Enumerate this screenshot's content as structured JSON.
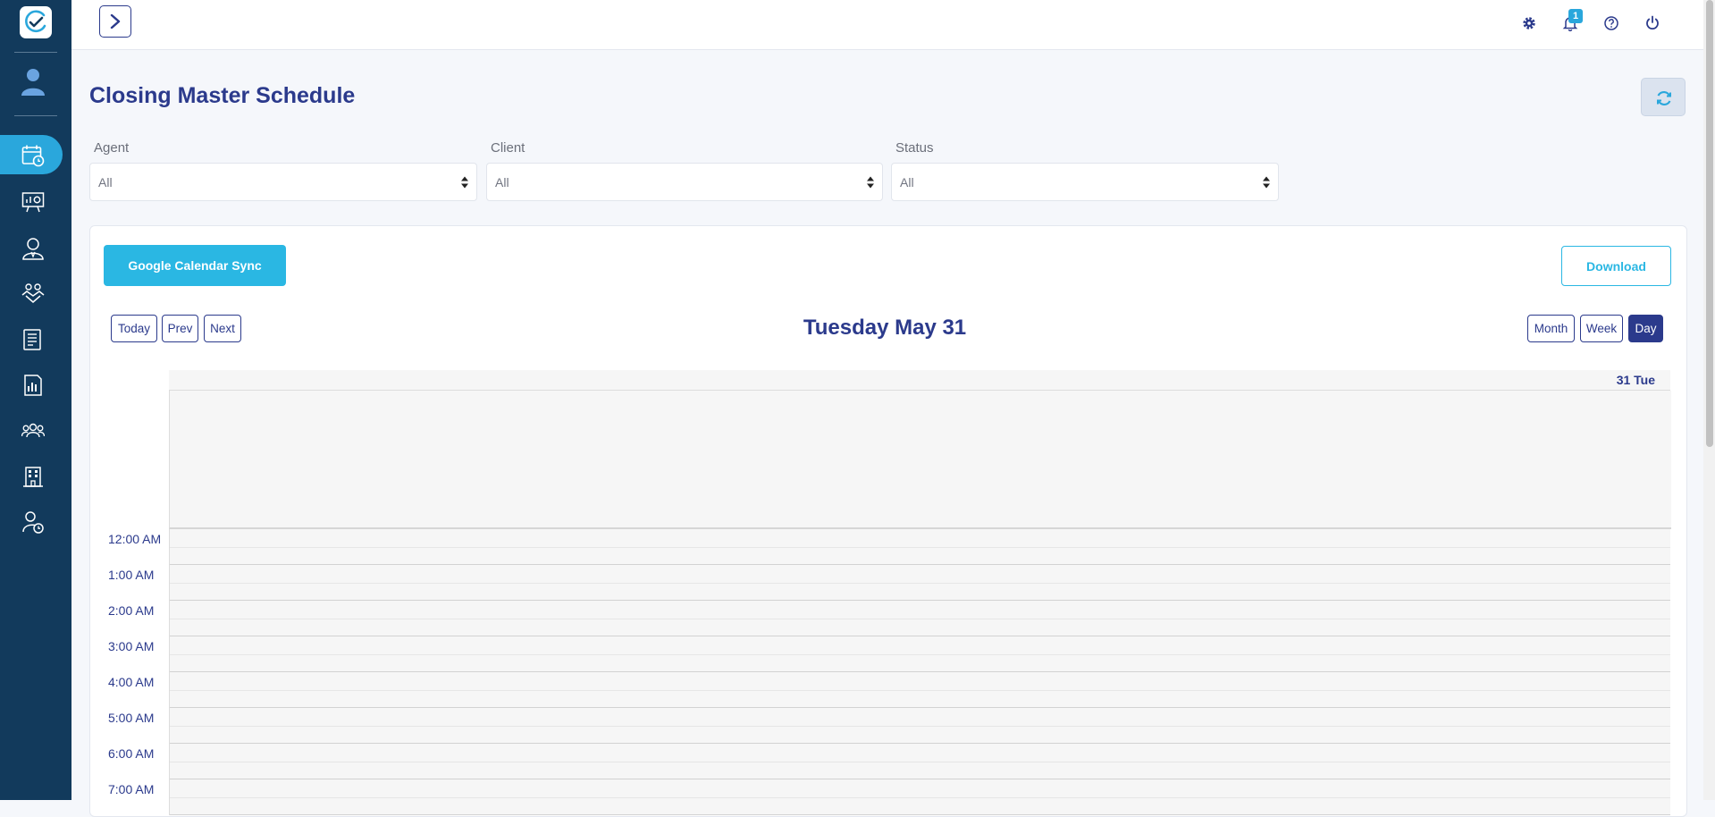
{
  "page": {
    "title": "Closing Master Schedule"
  },
  "colors": {
    "sidebar": "#123a5c",
    "accent": "#2aa7dc",
    "primary": "#2b3a8c",
    "button_blue": "#2ab7e3"
  },
  "topbar": {
    "notification_count": "1"
  },
  "sidebar": {
    "items": [
      {
        "icon": "calendar-clock-icon",
        "active": true
      },
      {
        "icon": "presentation-board-icon"
      },
      {
        "icon": "agent-icon"
      },
      {
        "icon": "handshake-icon"
      },
      {
        "icon": "ledger-book-icon"
      },
      {
        "icon": "bar-chart-report-icon"
      },
      {
        "icon": "team-icon"
      },
      {
        "icon": "building-icon"
      },
      {
        "icon": "user-clock-icon"
      }
    ]
  },
  "filters": {
    "agent": {
      "label": "Agent",
      "value": "All"
    },
    "client": {
      "label": "Client",
      "value": "All"
    },
    "status": {
      "label": "Status",
      "value": "All"
    }
  },
  "actions": {
    "google_sync": "Google Calendar Sync",
    "download": "Download"
  },
  "calendar": {
    "nav": {
      "today": "Today",
      "prev": "Prev",
      "next": "Next"
    },
    "views": {
      "month": "Month",
      "week": "Week",
      "day": "Day",
      "selected": "Day"
    },
    "title": "Tuesday May 31",
    "day_header": "31 Tue",
    "hours": [
      "12:00 AM",
      "1:00 AM",
      "2:00 AM",
      "3:00 AM",
      "4:00 AM",
      "5:00 AM",
      "6:00 AM",
      "7:00 AM"
    ]
  }
}
